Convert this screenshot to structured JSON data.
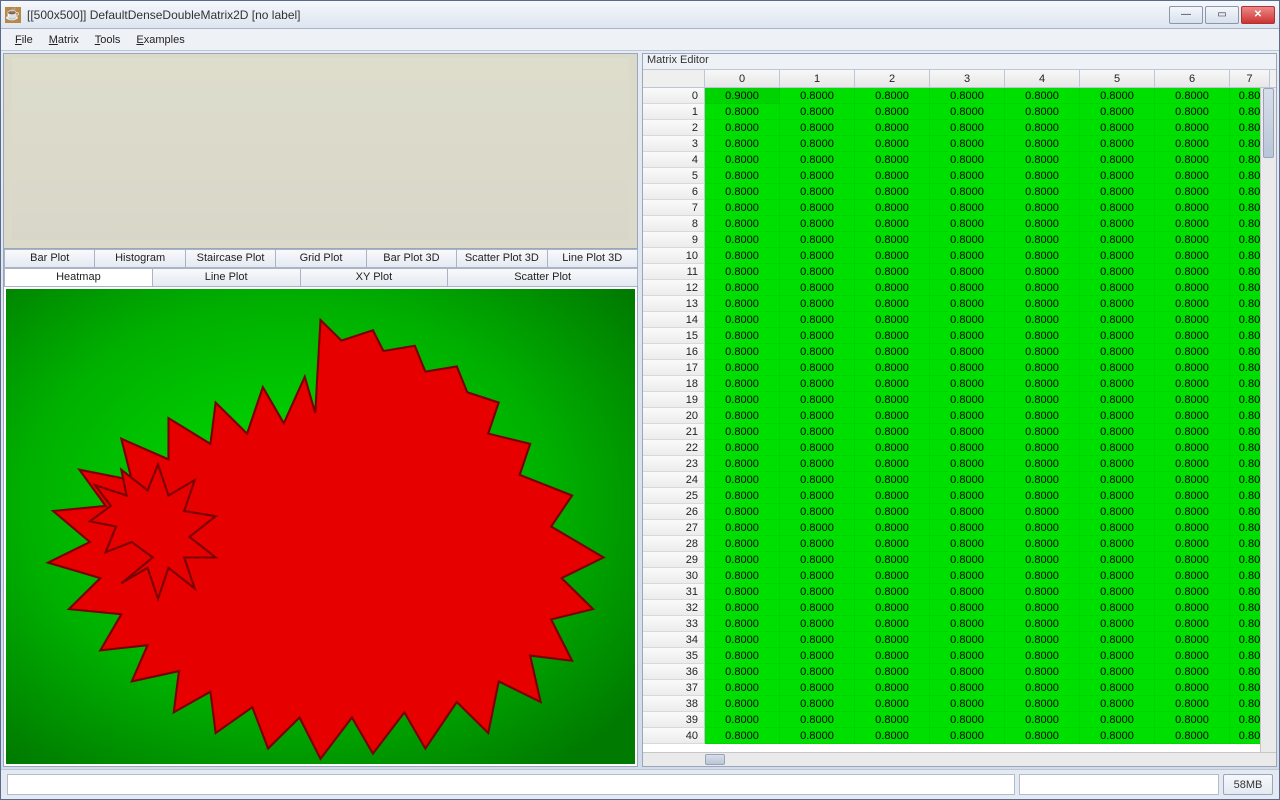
{
  "window_title": "[[500x500]] DefaultDenseDoubleMatrix2D [no label]",
  "menus": {
    "file": "File",
    "matrix": "Matrix",
    "tools": "Tools",
    "examples": "Examples"
  },
  "tabs_row1": [
    "Bar Plot",
    "Histogram",
    "Staircase Plot",
    "Grid Plot",
    "Bar Plot 3D",
    "Scatter Plot 3D",
    "Line Plot 3D"
  ],
  "tabs_row2": [
    "Heatmap",
    "Line Plot",
    "XY Plot",
    "Scatter Plot"
  ],
  "active_tab": "Heatmap",
  "right_title": "Matrix Editor",
  "columns": [
    "0",
    "1",
    "2",
    "3",
    "4",
    "5",
    "6",
    "7"
  ],
  "row_count": 41,
  "cell_default": "0.8000",
  "cell_last": "0.80",
  "cell_00": "0.9000",
  "status_mem": "58MB"
}
